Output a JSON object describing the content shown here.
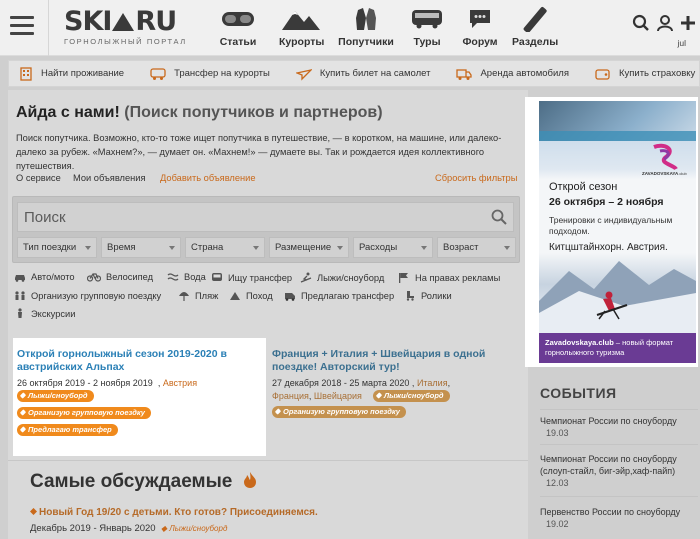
{
  "header": {
    "logo": {
      "text_a": "SKI",
      "text_b": "RU",
      "tagline": "ГОРНОЛЫЖНЫЙ ПОРТАЛ"
    },
    "nav": [
      {
        "label": "Статьи",
        "icon": "goggles-icon"
      },
      {
        "label": "Курорты",
        "icon": "mountains-icon"
      },
      {
        "label": "Попутчики",
        "icon": "gloves-icon"
      },
      {
        "label": "Туры",
        "icon": "bus-icon"
      },
      {
        "label": "Форум",
        "icon": "chat-icon"
      },
      {
        "label": "Разделы",
        "icon": "skis-icon"
      }
    ],
    "user": {
      "name": "jul"
    }
  },
  "subnav": [
    {
      "label": "Найти проживание",
      "icon": "building-icon"
    },
    {
      "label": "Трансфер на курорты",
      "icon": "transfer-bus-icon"
    },
    {
      "label": "Купить билет на самолет",
      "icon": "plane-icon"
    },
    {
      "label": "Аренда автомобиля",
      "icon": "truck-icon"
    },
    {
      "label": "Купить страховку",
      "icon": "wallet-icon"
    }
  ],
  "page": {
    "title_bold": "Айда с нами!",
    "title_rest": "(Поиск попутчиков и партнеров)",
    "intro": "Поиск попутчика. Возможно, кто-то тоже ищет попутчика в путешествие, — в коротком, на машине, или далеко-далеко за рубеж. «Махнем?», — думает он. «Махнем!» — думаете вы. Так и рождается идея коллективного путешествия.",
    "tabs": {
      "about": "О сервисе",
      "my_ads": "Мои объявления",
      "add_ad": "Добавить объявление",
      "reset": "Сбросить фильтры"
    }
  },
  "filters": {
    "search_placeholder": "Поиск",
    "selects": [
      "Тип поездки",
      "Время",
      "Страна",
      "Размещение",
      "Расходы",
      "Возраст"
    ]
  },
  "categories": [
    {
      "label": "Авто/мото",
      "icon": "car-icon"
    },
    {
      "label": "Велосипед",
      "icon": "bicycle-icon"
    },
    {
      "label": "Вода",
      "icon": "water-icon"
    },
    {
      "label": "Ищу трансфер",
      "icon": "bus-icon"
    },
    {
      "label": "Лыжи/сноуборд",
      "icon": "skier-icon"
    },
    {
      "label": "На правах рекламы",
      "icon": "flag-icon"
    },
    {
      "label": "Организую групповую поездку",
      "icon": "group-icon"
    },
    {
      "label": "Пляж",
      "icon": "umbrella-icon"
    },
    {
      "label": "Поход",
      "icon": "tent-icon"
    },
    {
      "label": "Предлагаю трансфер",
      "icon": "van-icon"
    },
    {
      "label": "Ролики",
      "icon": "roller-icon"
    },
    {
      "label": "Экскурсии",
      "icon": "person-icon"
    }
  ],
  "cards": [
    {
      "title": "Открой горнолыжный сезон 2019-2020 в австрийских Альпах",
      "dates": "26 октября 2019 - 2 ноября 2019",
      "sep": ",",
      "location": "Австрия",
      "tags": [
        "Лыжи/сноуборд",
        "Организую групповую поездку",
        "Предлагаю трансфер"
      ]
    },
    {
      "title": "Франция + Италия + Швейцария в одной поездке! Авторский тур!",
      "dates": "27 декабря 2018 - 25 марта 2020",
      "loc1": "Италия",
      "loc2": "Франция",
      "loc3": "Швейцария",
      "tags": [
        "Лыжи/сноуборд",
        "Организую групповую поездку"
      ]
    }
  ],
  "discussed": {
    "title": "Самые обсуждаемые",
    "link": "Новый Год 19/20 с детьми. Кто готов? Присоединяемся.",
    "dates": "Декабрь 2019 - Январь 2020",
    "tag": "Лыжи/сноуборд"
  },
  "ad": {
    "brand": "ZAVADOVSKAYA",
    "brand_sub": ".club",
    "line1": "Открой сезон",
    "line2": "26 октября – 2 ноября",
    "line3": "Тренировки с индивидуальным подходом.",
    "line4": "Китцштайнхорн. Австрия.",
    "foot_bold": "Zavadovskaya.club",
    "foot_rest": " – новый формат горнолыжного туризма"
  },
  "events": {
    "title": "СОБЫТИЯ",
    "items": [
      {
        "title": "Чемпионат России по сноуборду",
        "date": "19.03"
      },
      {
        "title": "Чемпионат России по сноуборду (слоуп-стайл, биг-эйр,хаф-пайп)",
        "date": "12.03"
      },
      {
        "title": "Первенство России по сноуборду",
        "date": "19.02"
      }
    ]
  },
  "colors": {
    "accent_orange": "#f08a1c",
    "link_blue": "#2b80b6",
    "ad_purple": "#6a3b94"
  }
}
